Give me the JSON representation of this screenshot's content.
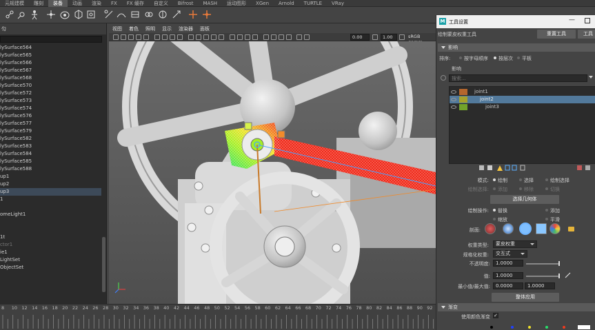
{
  "shelf_tabs": [
    {
      "label": "元规建模",
      "active": false
    },
    {
      "label": "雕刻",
      "active": false
    },
    {
      "label": "装备",
      "active": true
    },
    {
      "label": "动画",
      "active": false
    },
    {
      "label": "渲染",
      "active": false
    },
    {
      "label": "FX",
      "active": false
    },
    {
      "label": "FX 缓存",
      "active": false
    },
    {
      "label": "自定义",
      "active": false
    },
    {
      "label": "Bifrost",
      "active": false
    },
    {
      "label": "MASH",
      "active": false
    },
    {
      "label": "运动图形",
      "active": false
    },
    {
      "label": "XGen",
      "active": false
    },
    {
      "label": "Arnold",
      "active": false
    },
    {
      "label": "TURTLE",
      "active": false
    },
    {
      "label": "VRay",
      "active": false
    }
  ],
  "outliner": {
    "header": "匀",
    "items": [
      {
        "label": "lySurface564",
        "state": "normal"
      },
      {
        "label": "lySurface565",
        "state": "normal"
      },
      {
        "label": "lySurface566",
        "state": "normal"
      },
      {
        "label": "lySurface567",
        "state": "normal"
      },
      {
        "label": "lySurface568",
        "state": "normal"
      },
      {
        "label": "lySurface570",
        "state": "normal"
      },
      {
        "label": "lySurface572",
        "state": "normal"
      },
      {
        "label": "lySurface573",
        "state": "normal"
      },
      {
        "label": "lySurface574",
        "state": "normal"
      },
      {
        "label": "lySurface576",
        "state": "normal"
      },
      {
        "label": "lySurface577",
        "state": "normal"
      },
      {
        "label": "lySurface579",
        "state": "normal"
      },
      {
        "label": "lySurface582",
        "state": "normal"
      },
      {
        "label": "lySurface583",
        "state": "normal"
      },
      {
        "label": "lySurface584",
        "state": "normal"
      },
      {
        "label": "lySurface585",
        "state": "normal"
      },
      {
        "label": "lySurface588",
        "state": "normal"
      },
      {
        "label": "up1",
        "state": "normal"
      },
      {
        "label": "up2",
        "state": "normal"
      },
      {
        "label": "up3",
        "state": "selected"
      },
      {
        "label": "1",
        "state": "normal"
      },
      {
        "label": "",
        "state": "normal"
      },
      {
        "label": "omeLight1",
        "state": "normal"
      },
      {
        "label": "",
        "state": "normal"
      },
      {
        "label": "",
        "state": "normal"
      },
      {
        "label": "1t",
        "state": "normal"
      },
      {
        "label": "ctor1",
        "state": "dim"
      },
      {
        "label": "ie1",
        "state": "normal"
      },
      {
        "label": "LightSet",
        "state": "normal"
      },
      {
        "label": "ObjectSet",
        "state": "normal"
      }
    ]
  },
  "viewport": {
    "menu": [
      "视图",
      "着色",
      "照明",
      "显示",
      "渲染器",
      "面板"
    ],
    "exposure_value": "0.00",
    "gamma_value": "1.00",
    "colorspace_label": "sRGB gamm"
  },
  "timeline": {
    "ticks": [
      "8",
      "10",
      "12",
      "14",
      "16",
      "18",
      "20",
      "22",
      "24",
      "26",
      "28",
      "30",
      "32",
      "34",
      "36",
      "38",
      "40",
      "42",
      "44",
      "46",
      "48",
      "50",
      "52",
      "54",
      "56",
      "58",
      "60",
      "62",
      "64",
      "66",
      "68",
      "70",
      "72",
      "74",
      "76",
      "78",
      "80",
      "82",
      "84",
      "86",
      "88",
      "90",
      "92"
    ]
  },
  "tool_settings": {
    "window_title": "工具设置",
    "tool_name": "绘制蒙皮权重工具",
    "reset_button": "重置工具",
    "tool_help_button": "工具",
    "influence_section": "影响",
    "sort_label": "排序:",
    "sort_options": [
      "按字母顺序",
      "按层次",
      "平板"
    ],
    "sort_selected": "按层次",
    "influence_label": "影响",
    "search_placeholder": "搜索...",
    "joints": [
      {
        "name": "joint1",
        "indent": 0,
        "color": "#b5662d",
        "selected": false
      },
      {
        "name": "joint2",
        "indent": 1,
        "color": "#a7a22b",
        "selected": true
      },
      {
        "name": "joint3",
        "indent": 2,
        "color": "#73a32b",
        "selected": false
      }
    ],
    "mode_label": "模式:",
    "mode_options": [
      "绘制",
      "选择",
      "绘制选择"
    ],
    "mode_selected": "绘制",
    "paint_select_label": "绘制选择:",
    "paint_select_options": [
      "添加",
      "移除",
      "切换"
    ],
    "select_geometry_button": "选择几何体",
    "paint_op_label": "绘制操作:",
    "paint_ops": [
      "替换",
      "添加",
      "缩放",
      "平滑"
    ],
    "paint_op_selected": "替换",
    "profile_label": "剖面:",
    "weight_type_label": "权重类型:",
    "weight_type_value": "蒙皮权重",
    "normalize_label": "规格化权重:",
    "normalize_value": "交互式",
    "opacity_label": "不透明度:",
    "opacity_value": "1.0000",
    "opacity_fraction": 1.0,
    "value_label": "值:",
    "value_value": "1.0000",
    "value_fraction": 1.0,
    "minmax_label": "最小值/最大值:",
    "min_value": "0.0000",
    "max_value": "1.0000",
    "flood_button": "整体应用",
    "gradient_section": "渐变",
    "use_color_ramp_label": "使用颜色渐变",
    "use_color_ramp_checked": true
  }
}
